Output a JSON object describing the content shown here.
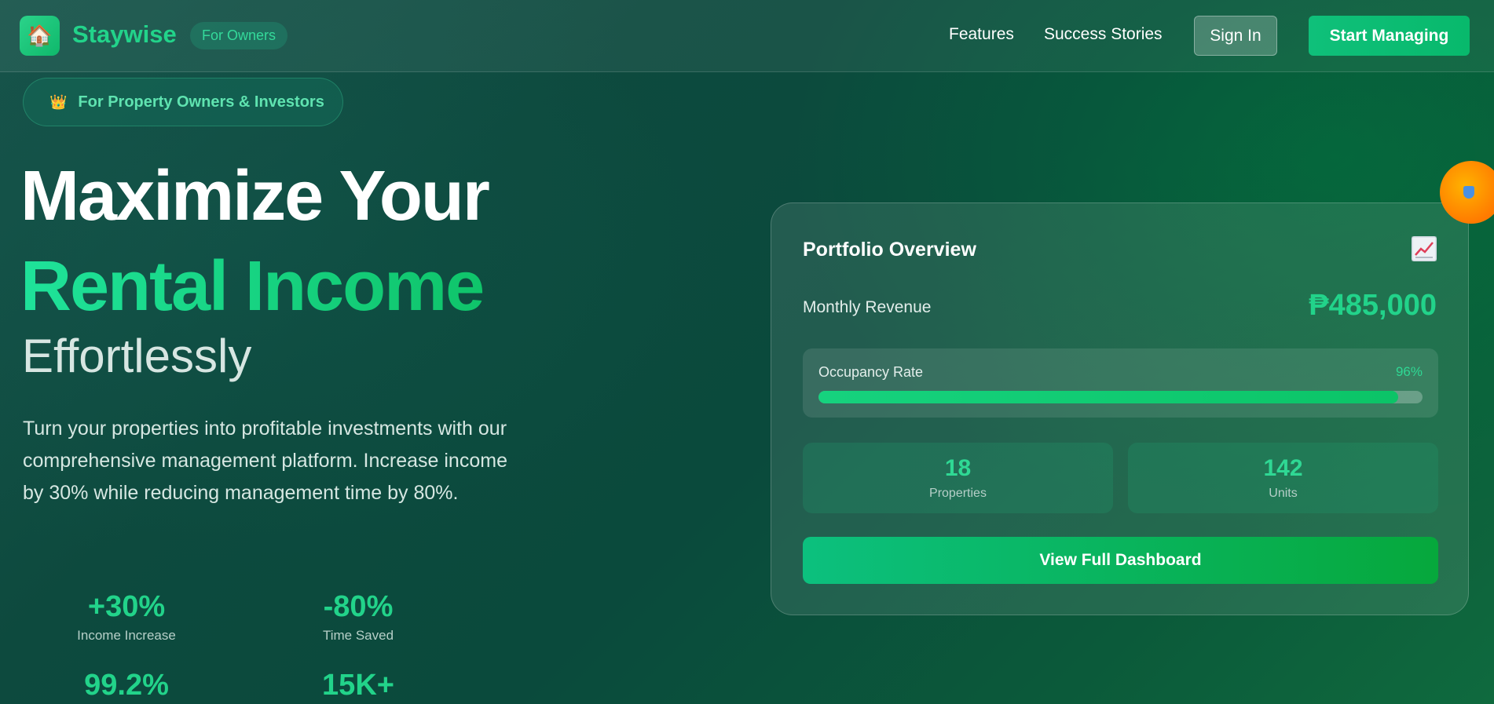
{
  "header": {
    "brand": "Staywise",
    "pill": "For Owners",
    "nav": [
      "Features",
      "Success Stories"
    ],
    "signin": "Sign In",
    "start": "Start Managing"
  },
  "hero": {
    "badge": "For Property Owners & Investors",
    "title_line1": "Maximize Your",
    "title_line2": "Rental Income",
    "title_line3": "Effortlessly",
    "description": "Turn your properties into profitable investments with our comprehensive management platform. Increase income by 30% while reducing management time by 80%.",
    "stats": [
      {
        "value": "+30%",
        "label": "Income Increase"
      },
      {
        "value": "-80%",
        "label": "Time Saved"
      },
      {
        "value": "99.2%",
        "label": ""
      },
      {
        "value": "15K+",
        "label": ""
      }
    ]
  },
  "card": {
    "title": "Portfolio Overview",
    "revenue_label": "Monthly Revenue",
    "revenue_value": "₱485,000",
    "occupancy_label": "Occupancy Rate",
    "occupancy_value": "96%",
    "occupancy_fraction": 0.96,
    "properties_value": "18",
    "properties_label": "Properties",
    "units_value": "142",
    "units_label": "Units",
    "dashboard_button": "View Full Dashboard"
  },
  "colors": {
    "accent": "#22d38a",
    "button": "#0cc07e"
  },
  "icons": {
    "logo": "house-icon",
    "badge": "crown-icon",
    "card": "chart-icon",
    "orb": "shield-icon"
  }
}
